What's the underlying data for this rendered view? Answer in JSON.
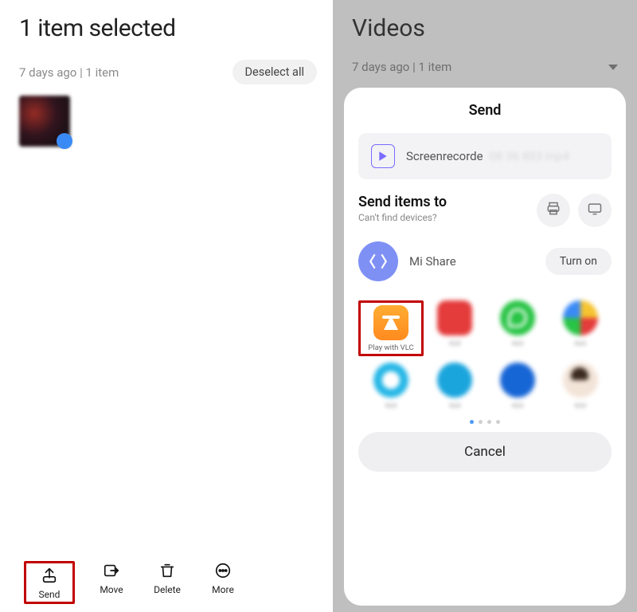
{
  "left": {
    "title": "1 item selected",
    "sub": "7 days ago  |  1 item",
    "deselect": "Deselect all",
    "actions": {
      "send": "Send",
      "move": "Move",
      "delete": "Delete",
      "more": "More"
    }
  },
  "right": {
    "title": "Videos",
    "sub": "7 days ago  |  1 item"
  },
  "sheet": {
    "title": "Send",
    "filename": "Screenrecorde",
    "send_to": "Send items to",
    "send_to_sub": "Can't find devices?",
    "mishare": "Mi Share",
    "turn_on": "Turn on",
    "vlc_caption": "Play with VLC",
    "cancel": "Cancel"
  }
}
